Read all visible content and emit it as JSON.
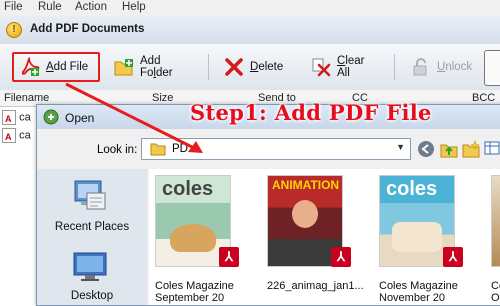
{
  "menu": [
    "File",
    "Rule",
    "Action",
    "Help"
  ],
  "app_title": "Add PDF Documents",
  "toolbar": {
    "add_file": {
      "pre": "",
      "u": "A",
      "post": "dd File"
    },
    "add_folder": {
      "pre": "Add Fo",
      "u": "l",
      "post": "der"
    },
    "delete": {
      "pre": "",
      "u": "D",
      "post": "elete"
    },
    "clear_all": {
      "pre": "",
      "u": "C",
      "post": "lear All"
    },
    "unlock": {
      "pre": "",
      "u": "U",
      "post": "nlock"
    }
  },
  "columns": [
    "Filename",
    "Size",
    "Send to",
    "CC",
    "BCC"
  ],
  "file_rows": [
    "ca",
    "ca"
  ],
  "dialog": {
    "title": "Open",
    "look_in_label": "Look in:",
    "look_in_value": "PD",
    "places": [
      "Recent Places",
      "Desktop"
    ],
    "files": [
      {
        "line1": "Coles Magazine",
        "line2": "September 20"
      },
      {
        "line1": "226_animag_jan1...",
        "line2": ""
      },
      {
        "line1": "Coles Magazine",
        "line2": "November 20"
      },
      {
        "line1": "Coles M",
        "line2": "October"
      }
    ]
  },
  "annotation": {
    "text": "Step1: Add PDF File",
    "color": "#e60d1f"
  },
  "colors": {
    "highlight_border": "#e51d1d",
    "pdf_badge": "#c9001e",
    "title_bar": "#d6dfea"
  },
  "icons": [
    "app-icon",
    "add-file-icon",
    "add-folder-icon",
    "delete-icon",
    "clear-all-icon",
    "unlock-icon",
    "pdf-file-icon",
    "folder-icon",
    "back-icon",
    "up-folder-icon",
    "new-folder-icon",
    "views-icon",
    "recent-places-icon",
    "desktop-icon"
  ]
}
